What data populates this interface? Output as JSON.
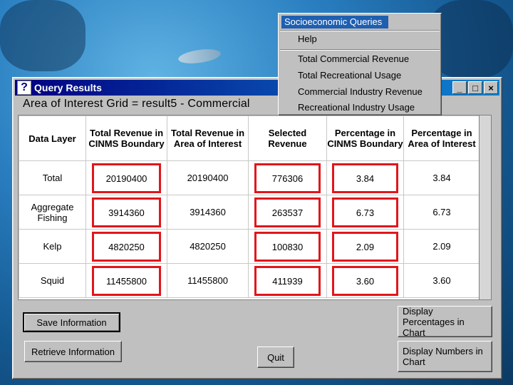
{
  "menu": {
    "title": "Socioeconomic Queries",
    "items": [
      "Help",
      "Total Commercial Revenue",
      "Total Recreational Usage",
      "Commercial Industry Revenue",
      "Recreational Industry Usage"
    ]
  },
  "window": {
    "icon": "?",
    "title": "Query Results",
    "buttons": {
      "minimize": "_",
      "maximize": "□",
      "close": "×"
    }
  },
  "subtitle": "Area of Interest Grid = result5  - Commercial",
  "table": {
    "headers": [
      "Data Layer",
      "Total Revenue in CINMS Boundary",
      "Total Revenue in Area of Interest",
      "Selected Revenue",
      "Percentage in CINMS Boundary",
      "Percentage in Area of Interest"
    ],
    "rows": [
      [
        "Total",
        "20190400",
        "20190400",
        "776306",
        "3.84",
        "3.84"
      ],
      [
        "Aggregate Fishing",
        "3914360",
        "3914360",
        "263537",
        "6.73",
        "6.73"
      ],
      [
        "Kelp",
        "4820250",
        "4820250",
        "100830",
        "2.09",
        "2.09"
      ],
      [
        "Squid",
        "11455800",
        "11455800",
        "411939",
        "3.60",
        "3.60"
      ]
    ],
    "highlight_color": "#e0161c"
  },
  "buttons": {
    "save": "Save Information",
    "retrieve": "Retrieve Information",
    "quit": "Quit",
    "display_percentages": "Display Percentages in Chart",
    "display_numbers": "Display Numbers in Chart"
  },
  "colors": {
    "titlebar": "#000080",
    "menu_title": "#1e5fb0",
    "dialog": "#c0c0c0"
  }
}
